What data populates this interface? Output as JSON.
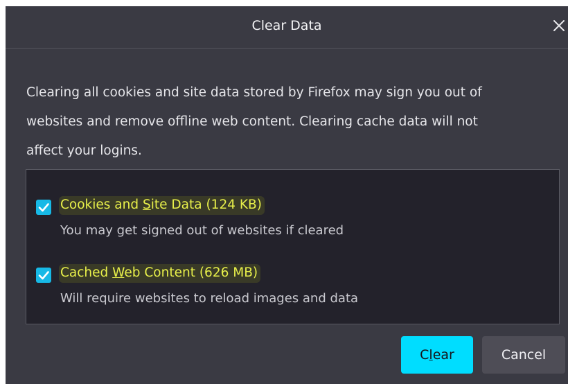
{
  "dialog": {
    "title": "Clear Data",
    "description_lines": [
      "Clearing all cookies and site data stored by Firefox may sign you out of",
      "websites and remove offline web content. Clearing cache data will not",
      "affect your logins."
    ]
  },
  "options": [
    {
      "label_pre": "Cookies and ",
      "label_access": "S",
      "label_post": "ite Data (124 KB)",
      "hint": "You may get signed out of websites if cleared",
      "checked": true
    },
    {
      "label_pre": "Cached ",
      "label_access": "W",
      "label_post": "eb Content (626 MB)",
      "hint": "Will require websites to reload images and data",
      "checked": true
    }
  ],
  "buttons": {
    "clear_pre": "C",
    "clear_access": "l",
    "clear_post": "ear",
    "cancel": "Cancel"
  },
  "colors": {
    "dialog_bg": "#3a3a43",
    "options_bg": "#23222b",
    "accent": "#00ddff",
    "checkbox": "#17b9e6",
    "highlight_text": "#e8f04a"
  },
  "icons": {
    "close": "close-icon",
    "check": "checkmark-icon"
  }
}
